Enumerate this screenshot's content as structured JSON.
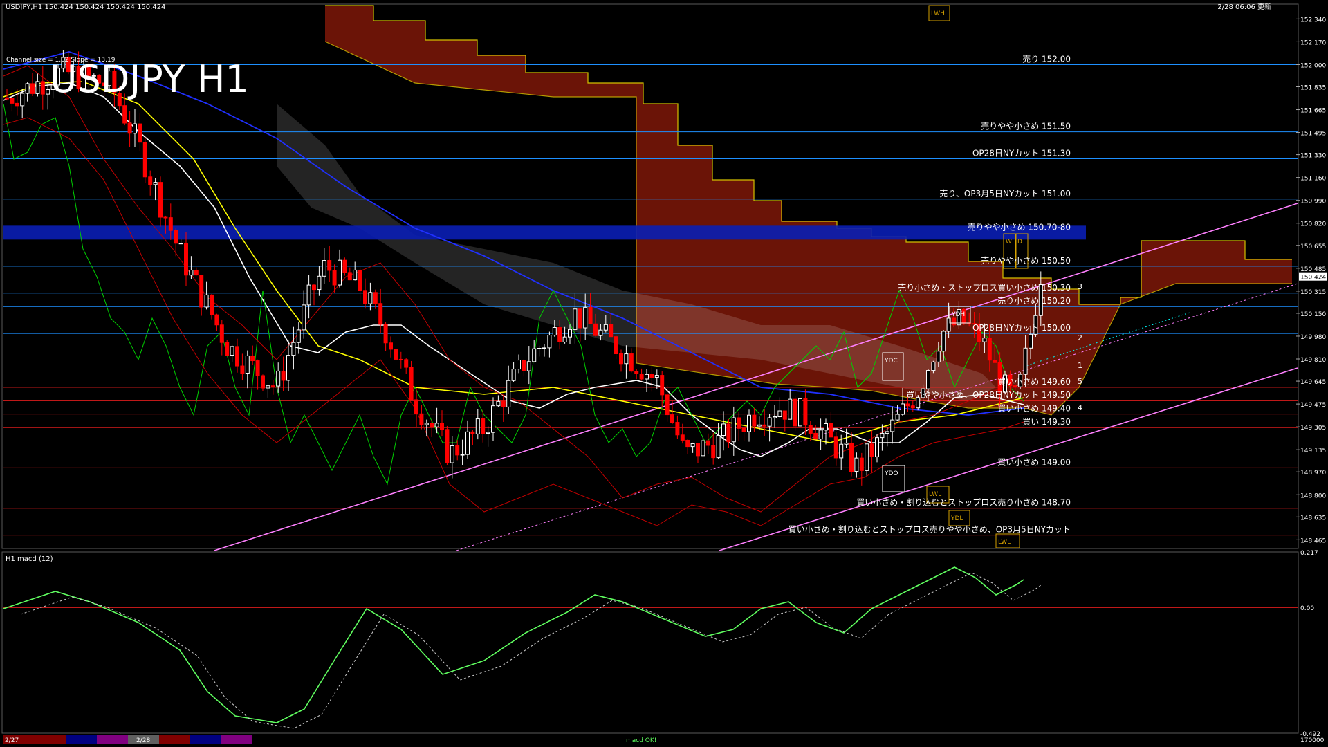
{
  "header": {
    "symbol_info": "USDJPY,H1  150.424 150.424 150.424 150.424",
    "updated": "2/28 06:06 更新",
    "title": "USDJPY H1",
    "channel_info": "Channel size = 1.02 Slope = 13.19"
  },
  "colors": {
    "background": "#000000",
    "bull": "#ffffff",
    "bear": "#ff0000",
    "resistance_line": "#1e90ff",
    "support_line": "#ff2020",
    "channel": "#ff80ff",
    "cloud": "#ff3010",
    "cloud_edge": "#d4c000",
    "ma_fast": "#ffffff",
    "ma_mid": "#ffff00",
    "ma_slow": "#2030ff",
    "chikou": "#00d000",
    "macd": "#60ff60",
    "macd_neg": "#ff80a0"
  },
  "chart_data": [
    {
      "type": "line",
      "title": "USDJPY H1",
      "ylim": [
        148.4,
        152.45
      ],
      "price_axis": {
        "ticks": [
          "152.340",
          "152.170",
          "152.000",
          "151.835",
          "151.665",
          "151.495",
          "151.330",
          "151.160",
          "150.990",
          "150.820",
          "150.655",
          "150.485",
          "150.315",
          "150.150",
          "149.980",
          "149.810",
          "149.645",
          "149.475",
          "149.305",
          "149.135",
          "148.970",
          "148.800",
          "148.635",
          "148.465"
        ],
        "current_price": "150.424"
      },
      "levels": [
        {
          "price": 152.0,
          "label": "売り 152.00",
          "kind": "sell"
        },
        {
          "price": 151.5,
          "label": "売りやや小さめ 151.50",
          "kind": "sell"
        },
        {
          "price": 151.3,
          "label": "OP28日NYカット 151.30",
          "kind": "sell"
        },
        {
          "price": 151.0,
          "label": "売り、OP3月5日NYカット 151.00",
          "kind": "sell"
        },
        {
          "price": 150.75,
          "label": "売りやや小さめ 150.70-80",
          "kind": "zone"
        },
        {
          "price": 150.5,
          "label": "売りやや小さめ 150.50",
          "kind": "sell"
        },
        {
          "price": 150.3,
          "label": "売り小さめ・ストップロス買い小さめ 150.30",
          "kind": "sell"
        },
        {
          "price": 150.2,
          "label": "売り小さめ 150.20",
          "kind": "sell"
        },
        {
          "price": 150.0,
          "label": "OP28日NYカット 150.00",
          "kind": "sell"
        },
        {
          "price": 149.6,
          "label": "買い小さめ 149.60",
          "kind": "buy"
        },
        {
          "price": 149.5,
          "label": "買いやや小さめ、OP28日NYカット 149.50",
          "kind": "buy"
        },
        {
          "price": 149.4,
          "label": "買い小さめ 149.40",
          "kind": "buy"
        },
        {
          "price": 149.3,
          "label": "買い 149.30",
          "kind": "buy"
        },
        {
          "price": 149.0,
          "label": "買い小さめ 149.00",
          "kind": "buy"
        },
        {
          "price": 148.7,
          "label": "買い小さめ・割り込むとストップロス売り小さめ 148.70",
          "kind": "buy"
        },
        {
          "price": 148.5,
          "label": "買い小さめ・割り込むとストップロス売りやや小さめ、OP3月5日NYカット",
          "kind": "buy"
        }
      ],
      "box_labels": [
        "LWH",
        "YDH",
        "YDC",
        "YDO",
        "LWL",
        "YDL",
        "W",
        "D",
        "LWL"
      ],
      "channel_labels": [
        "3",
        "2",
        "1",
        "5",
        "4"
      ],
      "x_axis": {
        "labels": [
          "2/27",
          "2/28"
        ]
      }
    },
    {
      "type": "line",
      "title": "H1 macd (12)",
      "ylim": [
        -0.492,
        0.217
      ],
      "axis_ticks": [
        "0.217",
        "0.00",
        "-0.492"
      ],
      "bottom_label": "macd OK!",
      "bottom_value": "170000"
    }
  ]
}
